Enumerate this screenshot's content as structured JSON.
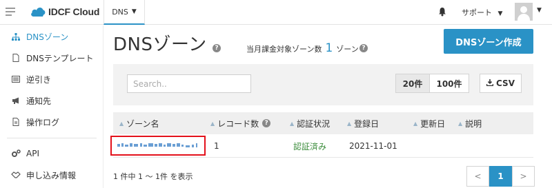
{
  "header": {
    "logo_text": "IDCF Cloud",
    "service_label": "DNS",
    "support_label": "サポート",
    "icons": [
      "menu-icon",
      "cloud-logo-icon",
      "chevron-down-icon",
      "bell-icon",
      "avatar"
    ]
  },
  "sidebar": {
    "items": [
      {
        "label": "DNSゾーン",
        "icon": "sitemap-icon",
        "active": true
      },
      {
        "label": "DNSテンプレート",
        "icon": "file-icon"
      },
      {
        "label": "逆引き",
        "icon": "list-icon"
      },
      {
        "label": "通知先",
        "icon": "megaphone-icon"
      },
      {
        "label": "操作ログ",
        "icon": "document-icon"
      },
      {
        "label": "API",
        "icon": "gears-icon"
      },
      {
        "label": "申し込み情報",
        "icon": "handshake-icon"
      }
    ]
  },
  "main": {
    "title": "DNSゾーン",
    "quota_label": "当月課金対象ゾーン数",
    "quota_count": "1",
    "quota_unit": "ゾーン",
    "create_button": "DNSゾーン作成",
    "search_placeholder": "Search..",
    "per_page": [
      {
        "label": "20件",
        "selected": true
      },
      {
        "label": "100件",
        "selected": false
      }
    ],
    "csv_label": "CSV"
  },
  "table": {
    "columns": [
      "ゾーン名",
      "レコード数",
      "認証状況",
      "登録日",
      "更新日",
      "説明"
    ],
    "rows": [
      {
        "zone": "",
        "records": "1",
        "status": "認証済み",
        "registered": "2021-11-01",
        "updated": "",
        "description": ""
      }
    ]
  },
  "footer": {
    "summary": "1 件中 1 〜 1件 を表示",
    "pages": [
      "<",
      "1",
      ">"
    ],
    "current_page": "1"
  },
  "colors": {
    "accent": "#2a92c6",
    "highlight_box": "#e3101a",
    "status_ok": "#3c8d3c"
  }
}
